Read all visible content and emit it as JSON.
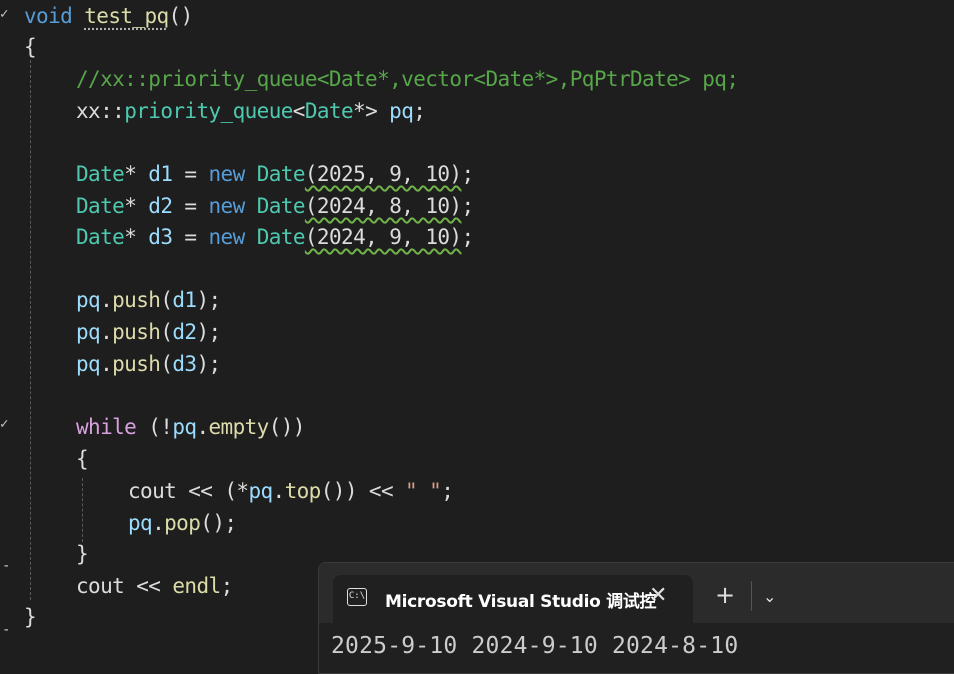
{
  "code": {
    "l1": {
      "void": "void",
      "fn": "test_pq",
      "parens": "()"
    },
    "l2": {
      "brace": "{"
    },
    "l3": {
      "comment": "//xx::priority_queue<Date*,vector<Date*>,PqPtrDate> pq;"
    },
    "l4": {
      "ns": "xx::",
      "type": "priority_queue",
      "targ_open": "<",
      "targ": "Date",
      "targ_close": "*>",
      "var": "pq",
      "semi": ";"
    },
    "l6": {
      "type": "Date",
      "star": "* ",
      "var": "d1",
      "eq": " = ",
      "new": "new",
      "ctor": "Date",
      "args": "(2025, 9, 10)",
      "semi": ";"
    },
    "l7": {
      "type": "Date",
      "star": "* ",
      "var": "d2",
      "eq": " = ",
      "new": "new",
      "ctor": "Date",
      "args": "(2024, 8, 10)",
      "semi": ";"
    },
    "l8": {
      "type": "Date",
      "star": "* ",
      "var": "d3",
      "eq": " = ",
      "new": "new",
      "ctor": "Date",
      "args": "(2024, 9, 10)",
      "semi": ";"
    },
    "l10": {
      "obj": "pq",
      "dot": ".",
      "fn": "push",
      "open": "(",
      "arg": "d1",
      "close": ");"
    },
    "l11": {
      "obj": "pq",
      "dot": ".",
      "fn": "push",
      "open": "(",
      "arg": "d2",
      "close": ");"
    },
    "l12": {
      "obj": "pq",
      "dot": ".",
      "fn": "push",
      "open": "(",
      "arg": "d3",
      "close": ");"
    },
    "l14": {
      "while": "while",
      "open": " (!",
      "obj": "pq",
      "dot": ".",
      "fn": "empty",
      "close": "())"
    },
    "l15": {
      "brace": "{"
    },
    "l16": {
      "cout": "cout",
      "op": " << (*",
      "obj": "pq",
      "dot": ".",
      "fn": "top",
      "close": "()) << ",
      "str": "\" \"",
      "semi": ";"
    },
    "l17": {
      "obj": "pq",
      "dot": ".",
      "fn": "pop",
      "close": "();"
    },
    "l18": {
      "brace": "}"
    },
    "l19": {
      "cout": "cout",
      "op": " << ",
      "fn": "endl",
      "semi": ";"
    },
    "l20": {
      "brace": "}"
    }
  },
  "terminal": {
    "tab_title": "Microsoft Visual Studio 调试控",
    "close_glyph": "✕",
    "new_tab_glyph": "+",
    "dropdown_glyph": "⌄",
    "icon_glyph": "C:\\",
    "output": "2025-9-10 2024-9-10 2024-8-10"
  },
  "colors": {
    "background": "#1e1e1e",
    "keyword": "#569cd6",
    "control_keyword": "#d8a0df",
    "type": "#4ec9b0",
    "function": "#dcdcaa",
    "variable": "#9cdcfe",
    "number": "#b5cea8",
    "comment": "#57a64a",
    "string": "#d69d85"
  }
}
